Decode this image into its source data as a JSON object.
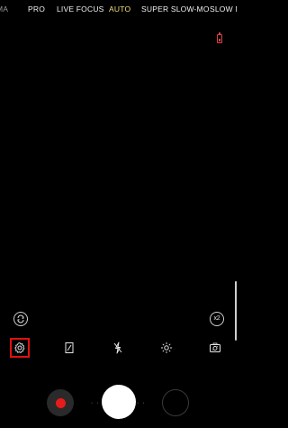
{
  "modes": [
    {
      "label": "MA",
      "active": false
    },
    {
      "label": "PRO",
      "active": false
    },
    {
      "label": "LIVE FOCUS",
      "active": false
    },
    {
      "label": "AUTO",
      "active": true
    },
    {
      "label": "SUPER SLOW-MO",
      "active": false
    },
    {
      "label": "SLOW M",
      "active": false
    }
  ],
  "icons": {
    "battery": "battery-low-icon",
    "switch_camera_small": "rotate-camera-icon",
    "settings": "gear-icon",
    "hdr": "hdr-icon",
    "flash": "flash-off-icon",
    "effects": "sparkle-icon",
    "switch_camera": "switch-camera-icon"
  },
  "zoom": {
    "label": "x2"
  },
  "colors": {
    "active_mode": "#f1e27a",
    "record": "#e81b1b",
    "highlight": "#e01010",
    "battery": "#dd4444"
  },
  "controls": {
    "dots_left": "· ·",
    "dots_right": "· ·"
  }
}
